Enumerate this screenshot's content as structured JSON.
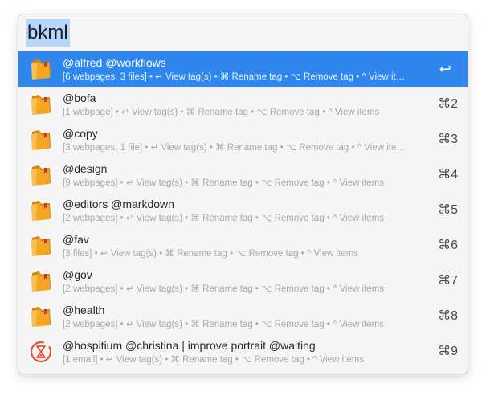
{
  "search": {
    "query": "bkml"
  },
  "results": [
    {
      "title": "@alfred @workflows",
      "subtitle": "[6 webpages, 3 files] • ↵ View tag(s) • ⌘ Rename tag • ⌥ Remove tag • ^ View it…",
      "shortcut": "↩",
      "icon": "bookmark-folder-icon",
      "selected": true
    },
    {
      "title": "@bofa",
      "subtitle": "[1 webpage] • ↵ View tag(s) • ⌘ Rename tag • ⌥ Remove tag • ^ View items",
      "shortcut": "⌘2",
      "icon": "bookmark-folder-icon"
    },
    {
      "title": "@copy",
      "subtitle": "[3 webpages, 1 file] • ↵ View tag(s) • ⌘ Rename tag • ⌥ Remove tag • ^ View ite…",
      "shortcut": "⌘3",
      "icon": "bookmark-folder-icon"
    },
    {
      "title": "@design",
      "subtitle": "[9 webpages] • ↵ View tag(s) • ⌘ Rename tag • ⌥ Remove tag • ^ View items",
      "shortcut": "⌘4",
      "icon": "bookmark-folder-icon"
    },
    {
      "title": "@editors @markdown",
      "subtitle": "[2 webpages] • ↵ View tag(s) • ⌘ Rename tag • ⌥ Remove tag • ^ View items",
      "shortcut": "⌘5",
      "icon": "bookmark-folder-icon"
    },
    {
      "title": "@fav",
      "subtitle": "[3 files] • ↵ View tag(s) • ⌘ Rename tag • ⌥ Remove tag • ^ View items",
      "shortcut": "⌘6",
      "icon": "bookmark-folder-icon"
    },
    {
      "title": "@gov",
      "subtitle": "[2 webpages] • ↵ View tag(s) • ⌘ Rename tag • ⌥ Remove tag • ^ View items",
      "shortcut": "⌘7",
      "icon": "bookmark-folder-icon"
    },
    {
      "title": "@health",
      "subtitle": "[2 webpages] • ↵ View tag(s) • ⌘ Rename tag • ⌥ Remove tag • ^ View items",
      "shortcut": "⌘8",
      "icon": "bookmark-folder-icon"
    },
    {
      "title": "@hospitium @christina | improve portrait @waiting",
      "subtitle": "[1 email] • ↵ View tag(s) • ⌘ Rename tag • ⌥ Remove tag • ^ View items",
      "shortcut": "⌘9",
      "icon": "hourglass-circle-icon"
    }
  ],
  "colors": {
    "selection": "#2f87ee",
    "query_highlight": "#b5d5fb",
    "folder_orange": "#f5a623",
    "hourglass_red": "#e8513a"
  }
}
